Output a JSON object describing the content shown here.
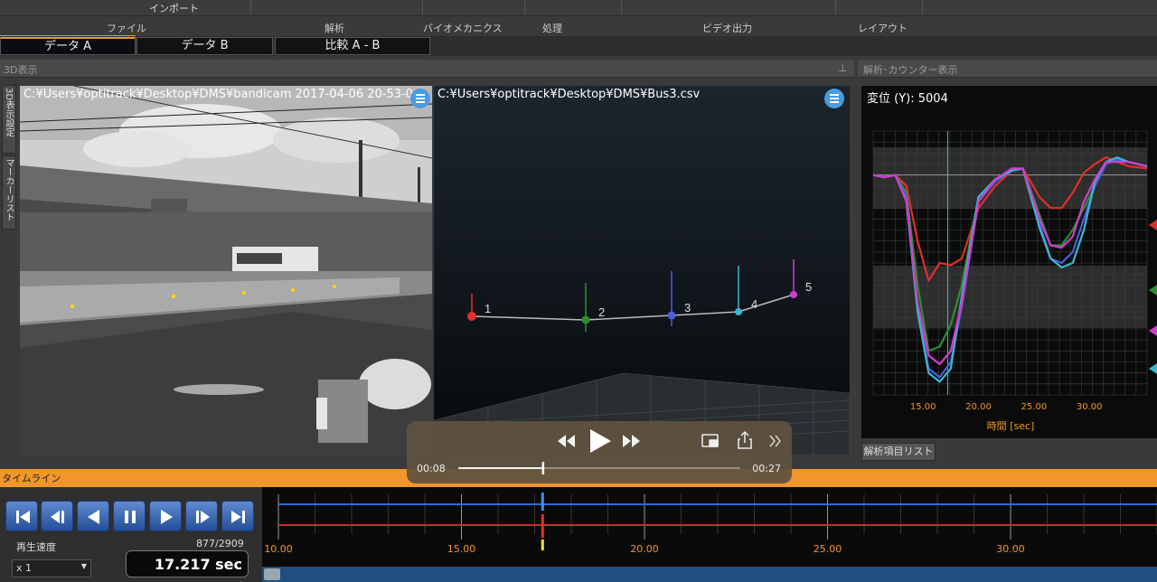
{
  "topbar": {
    "import_label": "インポート"
  },
  "menu": {
    "items": [
      "ファイル",
      "解析",
      "バイオメカニクス",
      "処理",
      "ビデオ出力",
      "レイアウト"
    ]
  },
  "tabs": [
    {
      "label": "データ A",
      "active": true
    },
    {
      "label": "データ B",
      "active": false
    },
    {
      "label": "比較 A - B",
      "active": false
    }
  ],
  "panel3d": {
    "title": "3D表示",
    "side_tabs": [
      "3D表示設定",
      "マーカーリスト"
    ],
    "video_path": "C:¥Users¥optitrack¥Desktop¥DMS¥bandicam 2017-04-06 20-53-0",
    "view_path": "C:¥Users¥optitrack¥Desktop¥DMS¥Bus3.csv",
    "markers": [
      {
        "label": "1",
        "color": "#e0302a"
      },
      {
        "label": "2",
        "color": "#2f8f2f"
      },
      {
        "label": "3",
        "color": "#4a5fd8"
      },
      {
        "label": "4",
        "color": "#3ab7d0"
      },
      {
        "label": "5",
        "color": "#d33cd0"
      }
    ]
  },
  "right_panel": {
    "title": "解析･カウンター表示",
    "display_label": "変位 (Y):",
    "display_value": "5004",
    "xaxis_label": "時間 [sec]",
    "list_tab": "解析項目リスト"
  },
  "chart_data": {
    "type": "line",
    "title": "",
    "xlabel": "時間 [sec]",
    "ylabel": "",
    "x_ticks": [
      "15.00",
      "20.00",
      "25.00",
      "30.00"
    ],
    "xlim": [
      10.5,
      35.2
    ],
    "ylim": [
      -100,
      20
    ],
    "grid": true,
    "x": [
      10.5,
      11.5,
      12.5,
      13.5,
      14.5,
      15.5,
      16.5,
      17.5,
      18.5,
      20,
      21.5,
      23,
      24,
      25.5,
      26.5,
      27.5,
      28.5,
      29.5,
      30.5,
      31.5,
      32.5,
      33.5,
      35.2
    ],
    "series": [
      {
        "color": "#e0302a",
        "values": [
          0,
          -1,
          0,
          -5,
          -30,
          -48,
          -40,
          -41,
          -38,
          -15,
          -5,
          2,
          3,
          -10,
          -15,
          -15,
          -8,
          1,
          5,
          8,
          6,
          4,
          3
        ]
      },
      {
        "color": "#2f8f2f",
        "values": [
          0,
          -1,
          0,
          -8,
          -50,
          -80,
          -78,
          -68,
          -50,
          -10,
          -2,
          2,
          3,
          -18,
          -32,
          -32,
          -25,
          -15,
          -5,
          5,
          7,
          6,
          4
        ]
      },
      {
        "color": "#4a5fd8",
        "values": [
          0,
          -1,
          0,
          -10,
          -60,
          -88,
          -92,
          -85,
          -60,
          -12,
          -3,
          2,
          3,
          -22,
          -38,
          -40,
          -35,
          -20,
          -5,
          5,
          7,
          6,
          4
        ]
      },
      {
        "color": "#3ab7d0",
        "values": [
          0,
          -1,
          0,
          -12,
          -62,
          -90,
          -94,
          -88,
          -55,
          -10,
          -2,
          2,
          3,
          -24,
          -38,
          -42,
          -40,
          -25,
          -3,
          6,
          8,
          6,
          4
        ]
      },
      {
        "color": "#d33cd0",
        "values": [
          0,
          -1,
          0,
          -12,
          -58,
          -82,
          -86,
          -80,
          -58,
          -12,
          -2,
          3,
          3,
          -20,
          -32,
          -33,
          -28,
          -12,
          -2,
          6,
          6,
          6,
          4
        ]
      }
    ]
  },
  "player": {
    "time_current": "00:08",
    "time_total": "00:27",
    "progress": 0.3
  },
  "timeline": {
    "title": "タイムライン",
    "speed_label": "再生速度",
    "speed_value": "x 1",
    "frame": "877/2909",
    "time": "17.217 sec",
    "ticks": [
      "10.00",
      "15.00",
      "20.00",
      "25.00",
      "30.00"
    ],
    "range": [
      9.6,
      34.0
    ],
    "cursor": 17.217
  }
}
